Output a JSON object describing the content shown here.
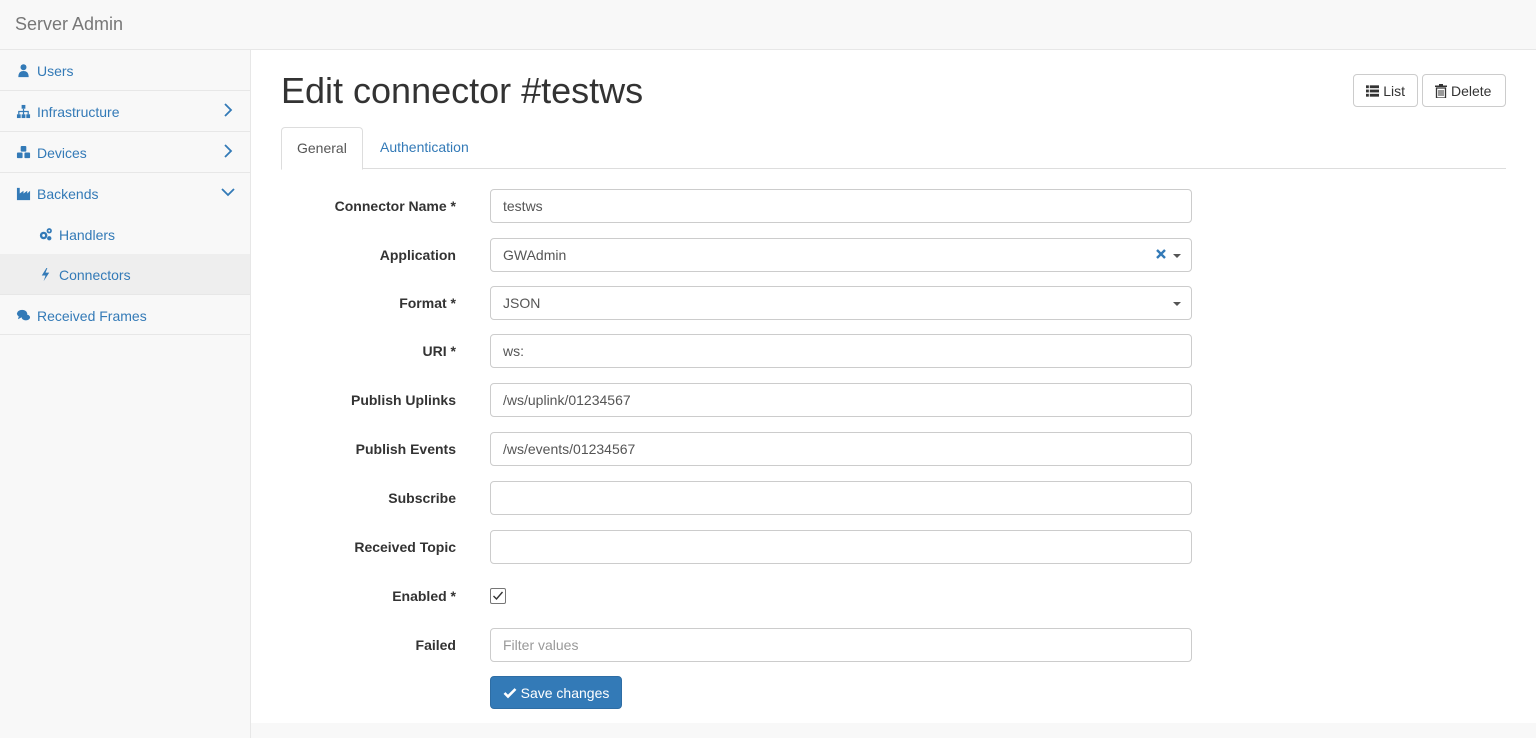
{
  "app": {
    "brand": "Server Admin"
  },
  "sidebar": {
    "items": [
      {
        "label": "Users",
        "icon": "user-icon"
      },
      {
        "label": "Infrastructure",
        "icon": "sitemap-icon",
        "chevron": "chevron-right-icon"
      },
      {
        "label": "Devices",
        "icon": "cubes-icon",
        "chevron": "chevron-right-icon"
      },
      {
        "label": "Backends",
        "icon": "industry-icon",
        "chevron": "chevron-down-icon"
      },
      {
        "label": "Handlers",
        "icon": "cogs-icon"
      },
      {
        "label": "Connectors",
        "icon": "bolt-icon",
        "active": true
      },
      {
        "label": "Received Frames",
        "icon": "comments-icon"
      }
    ]
  },
  "header": {
    "title": "Edit connector #testws",
    "list_label": "List",
    "delete_label": "Delete"
  },
  "tabs": [
    {
      "label": "General",
      "active": true
    },
    {
      "label": "Authentication",
      "active": false
    }
  ],
  "form": {
    "connector_name": {
      "label": "Connector Name *",
      "value": "testws"
    },
    "application": {
      "label": "Application",
      "value": "GWAdmin"
    },
    "format": {
      "label": "Format *",
      "value": "JSON"
    },
    "uri": {
      "label": "URI *",
      "value": "ws:"
    },
    "publish_uplinks": {
      "label": "Publish Uplinks",
      "value": "/ws/uplink/01234567"
    },
    "publish_events": {
      "label": "Publish Events",
      "value": "/ws/events/01234567"
    },
    "subscribe": {
      "label": "Subscribe",
      "value": ""
    },
    "received_topic": {
      "label": "Received Topic",
      "value": ""
    },
    "enabled": {
      "label": "Enabled *",
      "checked": true
    },
    "failed": {
      "label": "Failed",
      "placeholder": "Filter values"
    }
  },
  "actions": {
    "save_label": "Save changes"
  },
  "colors": {
    "link": "#337ab7",
    "primary": "#337ab7"
  }
}
